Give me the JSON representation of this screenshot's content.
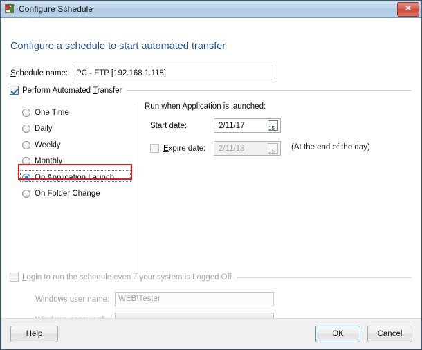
{
  "window": {
    "title": "Configure Schedule",
    "icon": "schedule-transfer-icon",
    "close_label": "✕",
    "accent_blue": "#1f4e9c",
    "highlight_red": "#e21b1b",
    "titlebar_color": "#b9d2e7"
  },
  "heading": "Configure a schedule to start automated transfer",
  "schedule": {
    "label": "Schedule name:",
    "label_accel": "S",
    "value": "PC - FTP [192.168.1.118]",
    "placeholder": ""
  },
  "automated_transfer": {
    "label": "Perform Automated Transfer",
    "label_accel": "T",
    "checked": true
  },
  "frequency": {
    "options": [
      {
        "label": "One Time",
        "selected": false
      },
      {
        "label": "Daily",
        "selected": false
      },
      {
        "label": "Weekly",
        "selected": false
      },
      {
        "label": "Monthly",
        "selected": false
      },
      {
        "label": "On Application Launch",
        "selected": true
      },
      {
        "label": "On Folder Change",
        "selected": false
      }
    ],
    "selected_value": "On Application Launch"
  },
  "run_panel": {
    "title": "Run when Application is launched:",
    "start_date": {
      "label": "Start date:",
      "label_accel": "d",
      "value": "2/11/17",
      "calendar_icon": "calendar-icon",
      "calendar_day": "15",
      "enabled": true
    },
    "expire_date": {
      "label": "Expire date:",
      "label_accel": "E",
      "value": "2/11/18",
      "calendar_icon": "calendar-icon",
      "calendar_day": "15",
      "checked": false,
      "enabled": false
    },
    "hint": "(At the end of the day)"
  },
  "logon": {
    "group_label": "Login to run the schedule even if your system is Logged Off",
    "group_label_accel": "L",
    "checked": false,
    "enabled": false,
    "user_name": {
      "label": "Windows user name:",
      "value": "WEB\\Tester"
    },
    "password": {
      "label": "Windows password:",
      "value": ""
    }
  },
  "footer": {
    "help": "Help",
    "ok": "OK",
    "cancel": "Cancel"
  }
}
